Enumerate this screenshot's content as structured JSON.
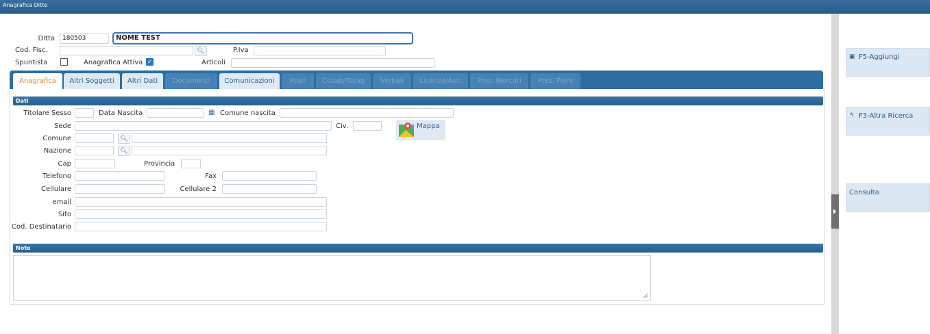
{
  "window": {
    "title": "Anagrafica Ditte"
  },
  "header": {
    "ditta_label": "Ditta",
    "ditta_code": "180503",
    "ditta_name": "NOME TEST",
    "codfisc_label": "Cod. Fisc.",
    "codfisc_value": "",
    "piva_label": "P.Iva",
    "piva_value": "",
    "spuntista_label": "Spuntista",
    "spuntista_checked": false,
    "attiva_label": "Anagrafica Attiva",
    "attiva_checked": true,
    "articoli_label": "Articoli",
    "articoli_value": ""
  },
  "tabs": [
    {
      "label": "Anagrafica",
      "state": "active"
    },
    {
      "label": "Altri Soggetti",
      "state": "enabled"
    },
    {
      "label": "Altri Dati",
      "state": "enabled"
    },
    {
      "label": "Documenti",
      "state": "disabled"
    },
    {
      "label": "Comunicazioni",
      "state": "enabled"
    },
    {
      "label": "Posti",
      "state": "disabled"
    },
    {
      "label": "Cosap/Tosap",
      "state": "disabled"
    },
    {
      "label": "Verbali",
      "state": "disabled"
    },
    {
      "label": "Licenze/Aut.",
      "state": "disabled"
    },
    {
      "label": "Pres. Mercati",
      "state": "disabled"
    },
    {
      "label": "Pres. Fiere",
      "state": "disabled"
    }
  ],
  "dati": {
    "section_title": "Dati",
    "titolare_sesso_label": "Titolare Sesso",
    "data_nascita_label": "Data Nascita",
    "comune_nascita_label": "Comune nascita",
    "sede_label": "Sede",
    "civ_label": "Civ.",
    "comune_label": "Comune",
    "nazione_label": "Nazione",
    "cap_label": "Cap",
    "provincia_label": "Provincia",
    "telefono_label": "Telefono",
    "fax_label": "Fax",
    "cellulare_label": "Cellulare",
    "cellulare2_label": "Cellulare 2",
    "email_label": "email",
    "sito_label": "Sito",
    "cod_destinatario_label": "Cod. Destinatario",
    "mappa_label": "Mappa"
  },
  "note": {
    "section_title": "Note",
    "value": ""
  },
  "sidebar": {
    "buttons": [
      {
        "label": "F5-Aggiungi",
        "icon": "save-icon"
      },
      {
        "label": "F3-Altra Ricerca",
        "icon": "back-arrow-icon"
      },
      {
        "label": "Consulta",
        "icon": ""
      }
    ]
  },
  "colors": {
    "titlebar": "#2f6596",
    "tab_strip": "#2d6da1",
    "active_tab_text": "#e0822a",
    "checkbox_checked": "#2c77c9",
    "side_button_bg": "#dde8f5"
  }
}
